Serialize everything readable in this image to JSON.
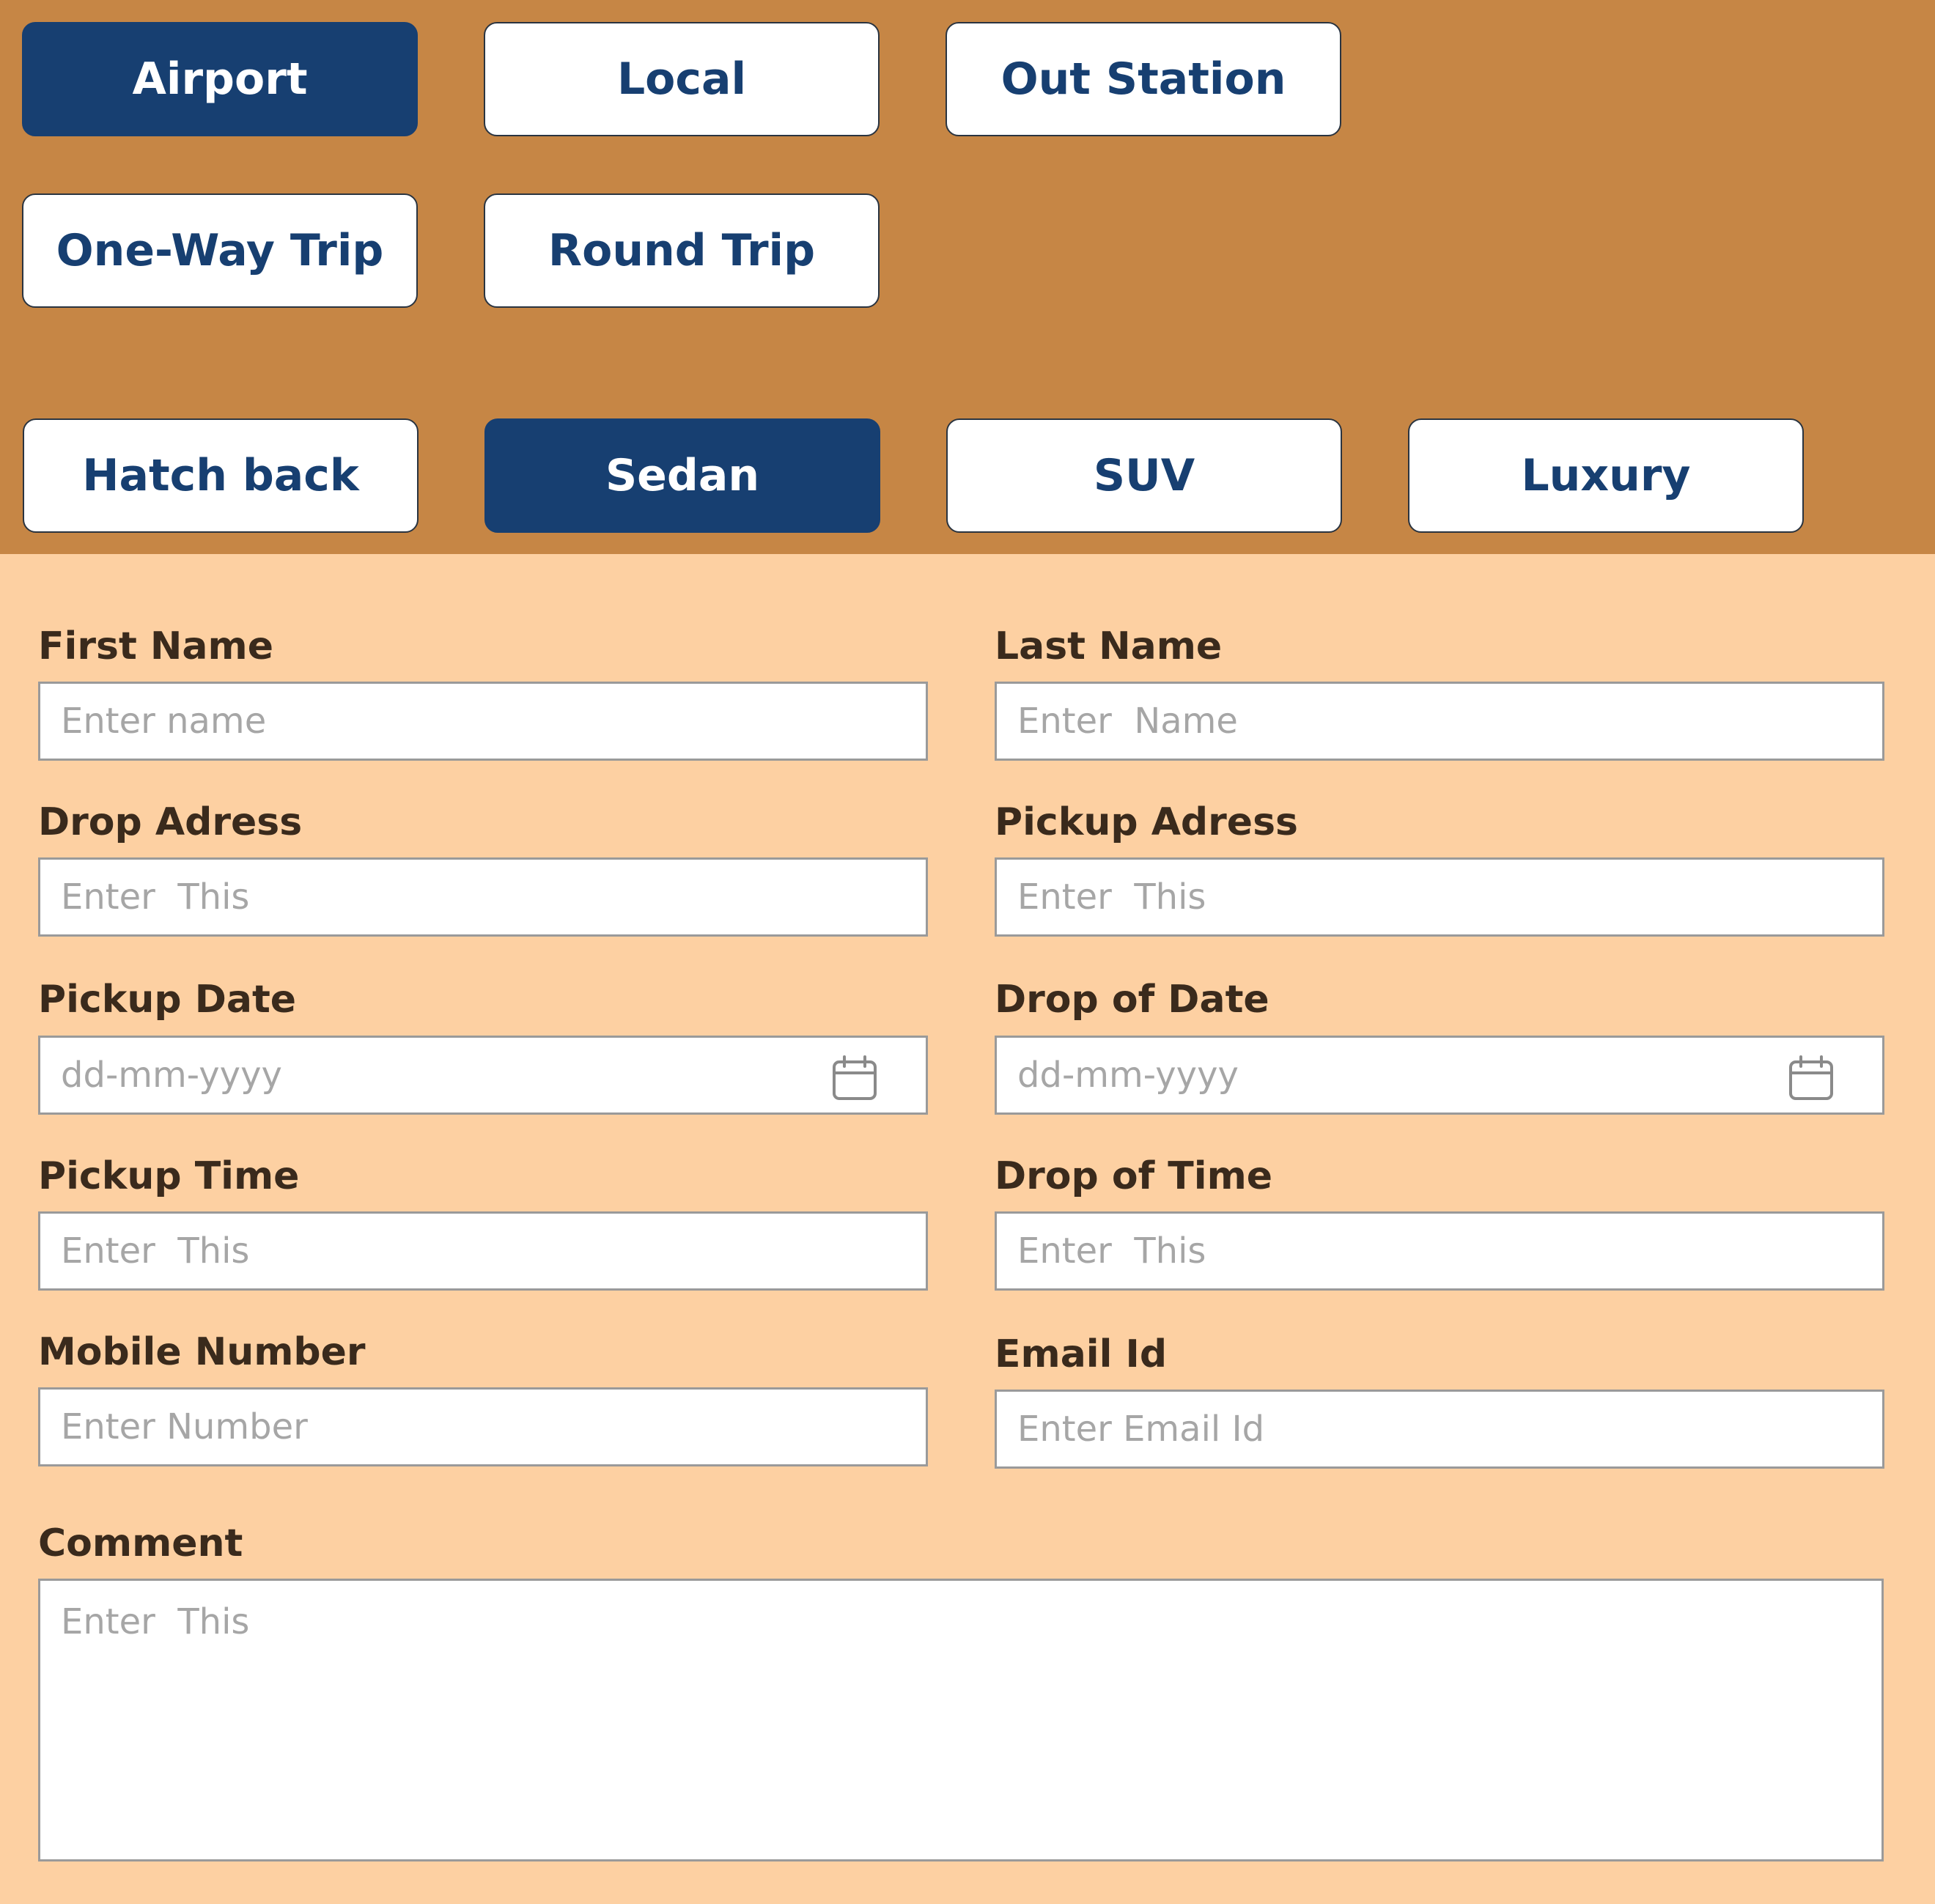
{
  "service_types": [
    {
      "label": "Airport",
      "active": true
    },
    {
      "label": "Local",
      "active": false
    },
    {
      "label": "Out Station",
      "active": false
    }
  ],
  "trip_types": [
    {
      "label": "One-Way Trip",
      "active": false
    },
    {
      "label": "Round Trip",
      "active": false
    }
  ],
  "car_types": [
    {
      "label": "Hatch back",
      "active": false
    },
    {
      "label": "Sedan",
      "active": true
    },
    {
      "label": "SUV",
      "active": false
    },
    {
      "label": "Luxury",
      "active": false
    }
  ],
  "form": {
    "first_name": {
      "label": "First Name",
      "placeholder": "Enter name"
    },
    "last_name": {
      "label": "Last Name",
      "placeholder": "Enter  Name"
    },
    "drop_address": {
      "label": "Drop Adress",
      "placeholder": "Enter  This"
    },
    "pickup_address": {
      "label": "Pickup Adress",
      "placeholder": "Enter  This"
    },
    "pickup_date": {
      "label": "Pickup Date",
      "placeholder": "dd-mm-yyyy",
      "icon": "calendar-icon"
    },
    "drop_date": {
      "label": "Drop of Date",
      "placeholder": "dd-mm-yyyy",
      "icon": "calendar-icon"
    },
    "pickup_time": {
      "label": "Pickup Time",
      "placeholder": "Enter  This"
    },
    "drop_time": {
      "label": "Drop of Time",
      "placeholder": "Enter  This"
    },
    "mobile": {
      "label": "Mobile Number",
      "placeholder": "Enter Number"
    },
    "email": {
      "label": "Email Id",
      "placeholder": "Enter Email Id"
    },
    "comment": {
      "label": "Comment",
      "placeholder": "Enter  This"
    }
  },
  "colors": {
    "top_background": "#c68645",
    "form_background": "#fdd0a2",
    "accent_navy": "#173f71",
    "label_text": "#3a2a1c",
    "placeholder_text": "#a6a6a6"
  }
}
